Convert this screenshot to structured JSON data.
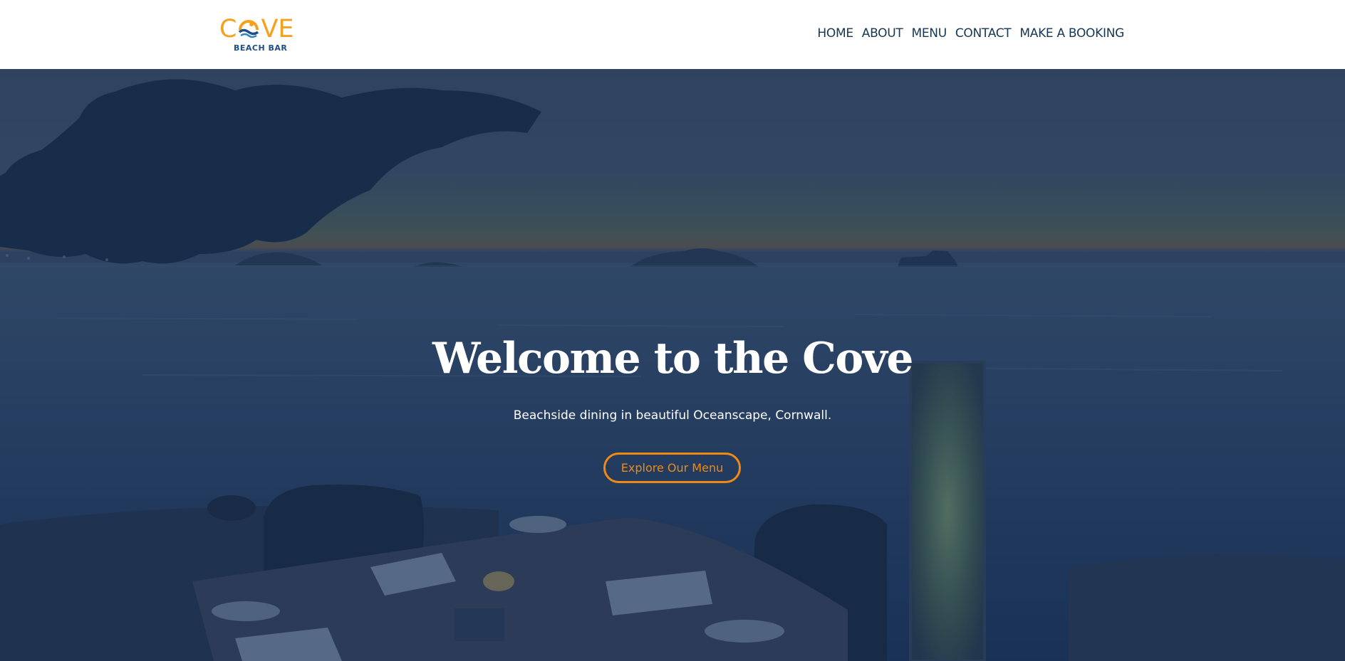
{
  "brand": {
    "logo_main": "COVE",
    "logo_letters": [
      "C",
      "V",
      "E"
    ],
    "logo_sub": "BEACH BAR",
    "accent_color": "#f5a11c",
    "secondary_color": "#1f4f86"
  },
  "nav": {
    "items": [
      {
        "label": "HOME"
      },
      {
        "label": "ABOUT"
      },
      {
        "label": "MENU"
      },
      {
        "label": "CONTACT"
      },
      {
        "label": "MAKE A BOOKING"
      }
    ]
  },
  "hero": {
    "title": "Welcome to the Cove",
    "subtitle": "Beachside dining in beautiful Oceanscape, Cornwall.",
    "cta_label": "Explore Our Menu",
    "cta_color": "#f08a14",
    "background_description_icon": "beach-sunset-dining-photo"
  }
}
